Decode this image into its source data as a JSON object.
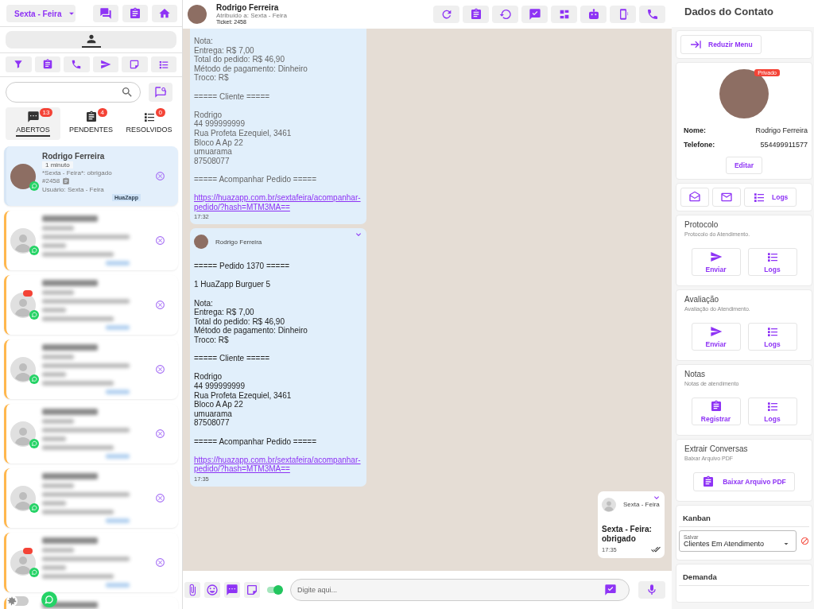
{
  "sidebar": {
    "queue_selector": {
      "value": "Sexta - Feira"
    },
    "theme_toggle": {
      "on": false
    },
    "status_tabs": [
      {
        "label": "ABERTOS",
        "count": "13",
        "selected": true
      },
      {
        "label": "PENDENTES",
        "count": "4",
        "selected": false
      },
      {
        "label": "RESOLVIDOS",
        "count": "0",
        "selected": false
      }
    ],
    "tickets": [
      {
        "kind": "full",
        "name": "Rodrigo Ferreira",
        "time": "1 minuto",
        "last_message": "*Sexta - Feira*: obrigado",
        "ticket": "#2458",
        "user": "Usuário: Sexta - Feira",
        "tag": "HuaZapp",
        "selected": true,
        "unread": false
      },
      {
        "kind": "blurred",
        "selected": false,
        "unread": false
      },
      {
        "kind": "blurred",
        "selected": false,
        "unread": true
      },
      {
        "kind": "blurred",
        "selected": false,
        "unread": false
      },
      {
        "kind": "blurred",
        "selected": false,
        "unread": false
      },
      {
        "kind": "blurred",
        "selected": false,
        "unread": false
      },
      {
        "kind": "blurred",
        "selected": false,
        "unread": true
      },
      {
        "kind": "blurred",
        "selected": false
      }
    ]
  },
  "chat": {
    "header": {
      "name": "Rodrigo Ferreira",
      "assigned": "Atribuído a: Sexta - Feira",
      "ticket": "Ticket: 2458"
    },
    "messages": [
      {
        "kind": "incoming",
        "body": "Nota:\nEntrega: R$ 7,00\nTotal do pedido: R$ 46,90\nMétodo de pagamento: Dinheiro\nTroco: R$\n\n===== Cliente =====\n\nRodrigo\n44 999999999\nRua Profeta Ezequiel, 3461\nBloco A Ap 22\numuarama\n87508077\n\n===== Acompanhar Pedido =====",
        "link": "https://huazapp.com.br/sextafeira/acompanhar-pedido/?hash=MTM3MA==",
        "time": "17:32",
        "faded": true
      },
      {
        "kind": "incoming",
        "sender": "Rodrigo Ferreira",
        "body": "===== Pedido 1370 =====\n\n1 HuaZapp Burguer 5\n\nNota:\nEntrega: R$ 7,00\nTotal do pedido: R$ 46,90\nMétodo de pagamento: Dinheiro\nTroco: R$\n\n===== Cliente =====\n\nRodrigo\n44 999999999\nRua Profeta Ezequiel, 3461\nBloco A Ap 22\numuarama\n87508077\n\n===== Acompanhar Pedido =====",
        "link": "https://huazapp.com.br/sextafeira/acompanhar-pedido/?hash=MTM3MA==",
        "time": "17:35",
        "faded": false
      },
      {
        "kind": "outgoing",
        "sender": "Sexta - Feira",
        "body": "Sexta - Feira: obrigado",
        "time": "17:35",
        "read": true,
        "faded": false
      }
    ],
    "composer": {
      "placeholder": "Digite aqui...",
      "signature_on": true
    }
  },
  "contact_panel": {
    "title": "Dados do Contato",
    "collapse_button": "Reduzir Menu",
    "badge": "Privado",
    "fields": [
      {
        "label": "Nome:",
        "value": "Rodrigo Ferreira"
      },
      {
        "label": "Telefone:",
        "value": "554499911577"
      }
    ],
    "edit_button": "Editar",
    "logs_button": "Logs",
    "sections": [
      {
        "title": "Protocolo",
        "subtitle": "Protocolo do Atendimento.",
        "buttons": [
          {
            "kind": "send",
            "label": "Enviar"
          },
          {
            "kind": "logs",
            "label": "Logs"
          }
        ]
      },
      {
        "title": "Avaliação",
        "subtitle": "Avaliação do Atendimento.",
        "buttons": [
          {
            "kind": "send",
            "label": "Enviar"
          },
          {
            "kind": "logs",
            "label": "Logs"
          }
        ]
      },
      {
        "title": "Notas",
        "subtitle": "Notas de atendimento",
        "buttons": [
          {
            "kind": "register",
            "label": "Registrar"
          },
          {
            "kind": "logs",
            "label": "Logs"
          }
        ]
      },
      {
        "title": "Extrair Conversas",
        "subtitle": "Baixar Arquivo PDF",
        "buttons": [
          {
            "kind": "pdf",
            "label": "Baixar Arquivo PDF"
          }
        ]
      }
    ],
    "kanban": {
      "title": "Kanban",
      "select_label": "Salvar",
      "value": "Clientes Em Atendimento"
    },
    "next_section": "Demanda"
  }
}
